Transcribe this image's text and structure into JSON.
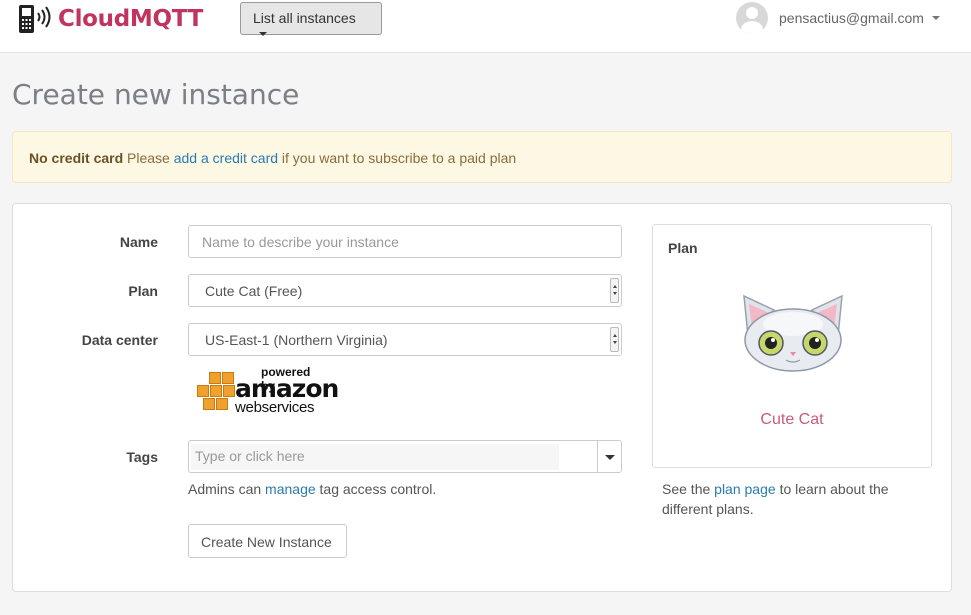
{
  "brand": {
    "name": "CloudMQTT",
    "color": "#c0345e"
  },
  "nav": {
    "instances_button": "List all instances"
  },
  "user": {
    "email": "pensactius@gmail.com"
  },
  "page": {
    "title": "Create new instance"
  },
  "alert": {
    "strong": "No credit card",
    "text_before": "Please",
    "link": "add a credit card",
    "text_after": "if you want to subscribe to a paid plan"
  },
  "form": {
    "name_label": "Name",
    "name_placeholder": "Name to describe your instance",
    "plan_label": "Plan",
    "plan_value": "Cute Cat (Free)",
    "datacenter_label": "Data center",
    "datacenter_value": "US-East-1 (Northern Virginia)",
    "aws": {
      "powered": "powered by",
      "amazon": "amazon",
      "webservices": "webservices"
    },
    "tags_label": "Tags",
    "tags_placeholder": "Type or click here",
    "tags_help_before": "Admins can",
    "tags_help_link": "manage",
    "tags_help_after": "tag access control.",
    "submit": "Create New Instance"
  },
  "plan_box": {
    "title": "Plan",
    "plan_name": "Cute Cat",
    "help_before": "See the",
    "help_link": "plan page",
    "help_after": "to learn about the different plans."
  }
}
